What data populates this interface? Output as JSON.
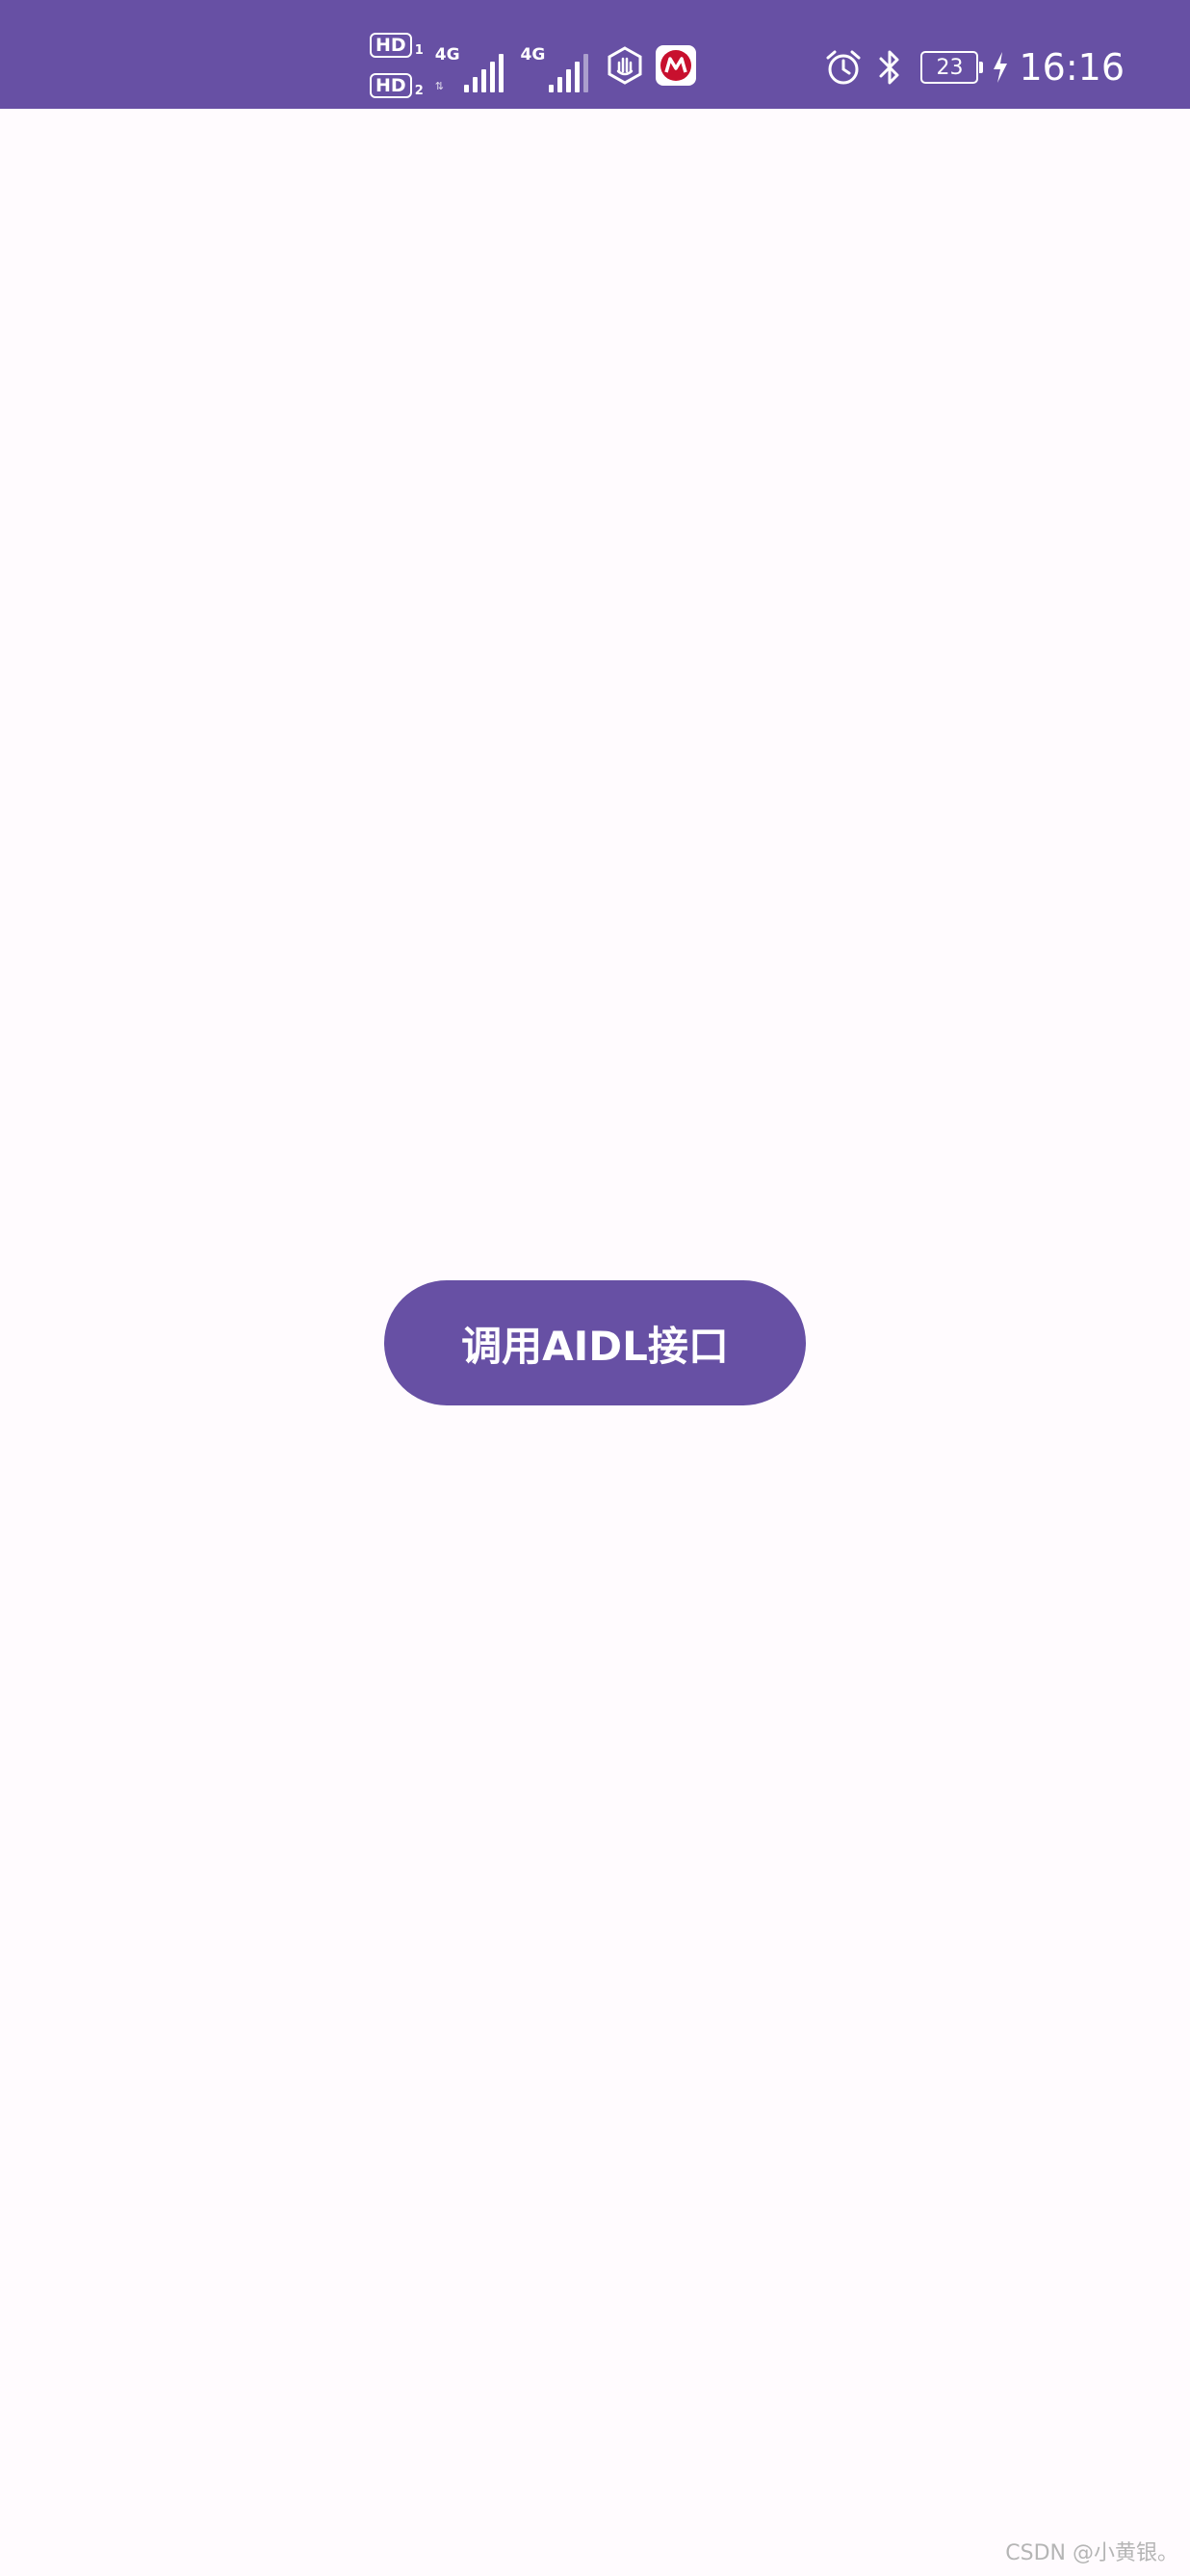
{
  "status_bar": {
    "sim1_label": "HD",
    "sim1_index": "1",
    "sim2_label": "HD",
    "sim2_index": "2",
    "network1": "4G",
    "network2": "4G",
    "battery_level": "23",
    "time": "16:16",
    "background_color": "#6750a4",
    "icons": [
      "signal-icon",
      "hexagon-hand-icon",
      "app-logo-icon",
      "alarm-icon",
      "bluetooth-icon",
      "battery-icon",
      "charging-icon"
    ]
  },
  "main": {
    "button_label": "调用AIDL接口",
    "button_color": "#6750a4"
  },
  "watermark": "CSDN @小黄银。",
  "background_color": "#fffbfe"
}
